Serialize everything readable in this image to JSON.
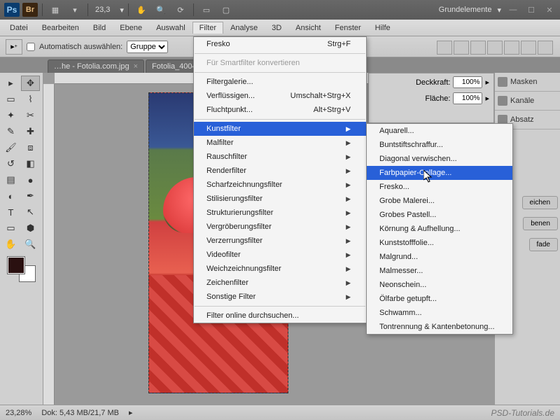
{
  "titlebar": {
    "zoom": "23,3",
    "workspace": "Grundelemente"
  },
  "menubar": [
    "Datei",
    "Bearbeiten",
    "Bild",
    "Ebene",
    "Auswahl",
    "Filter",
    "Analyse",
    "3D",
    "Ansicht",
    "Fenster",
    "Hilfe"
  ],
  "options": {
    "auto_label": "Automatisch auswählen:",
    "group_label": "Gruppe"
  },
  "tabs": [
    {
      "label": "…he - Fotolia.com.jpg"
    },
    {
      "label": "Fotolia_4004…"
    }
  ],
  "filtermenu": {
    "top": {
      "label": "Fresko",
      "shortcut": "Strg+F"
    },
    "smart": "Für Smartfilter konvertieren",
    "gallery": "Filtergalerie...",
    "liquify": {
      "label": "Verflüssigen...",
      "shortcut": "Umschalt+Strg+X"
    },
    "vanish": {
      "label": "Fluchtpunkt...",
      "shortcut": "Alt+Strg+V"
    },
    "groups": [
      "Kunstfilter",
      "Malfilter",
      "Rauschfilter",
      "Renderfilter",
      "Scharfzeichnungsfilter",
      "Stilisierungsfilter",
      "Strukturierungsfilter",
      "Vergröberungsfilter",
      "Verzerrungsfilter",
      "Videofilter",
      "Weichzeichnungsfilter",
      "Zeichenfilter",
      "Sonstige Filter"
    ],
    "online": "Filter online durchsuchen..."
  },
  "submenu": [
    "Aquarell...",
    "Buntstiftschraffur...",
    "Diagonal verwischen...",
    "Farbpapier-Collage...",
    "Fresko...",
    "Grobe Malerei...",
    "Grobes Pastell...",
    "Körnung & Aufhellung...",
    "Kunststofffolie...",
    "Malgrund...",
    "Malmesser...",
    "Neonschein...",
    "Ölfarbe getupft...",
    "Schwamm...",
    "Tontrennung & Kantenbetonung..."
  ],
  "props": {
    "deck_label": "Deckkraft:",
    "deck_val": "100%",
    "flache_label": "Fläche:",
    "flache_val": "100%"
  },
  "rightpanels": [
    "Masken",
    "Kanäle",
    "Absatz",
    "eichen",
    "benen",
    "fade"
  ],
  "status": {
    "zoom": "23,28%",
    "doc": "Dok: 5,43 MB/21,7 MB",
    "watermark": "PSD-Tutorials.de"
  }
}
